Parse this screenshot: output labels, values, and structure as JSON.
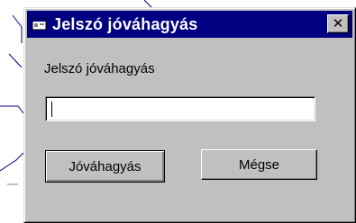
{
  "dialog": {
    "title": "Jelszó jóváhagyás",
    "title_icon": "window-app-icon",
    "close_glyph": "✕",
    "prompt_label": "Jelszó jóváhagyás",
    "password_value": "",
    "confirm_label": "Jóváhagyás",
    "cancel_label": "Mégse"
  },
  "colors": {
    "title_bar": "#000080",
    "face": "#c0c0c0"
  }
}
